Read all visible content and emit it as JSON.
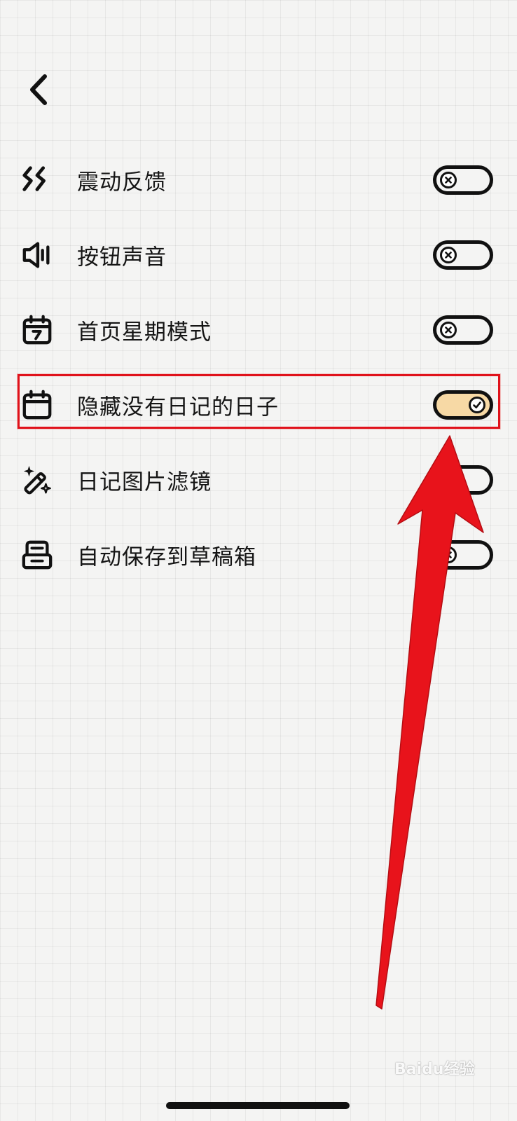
{
  "settings": [
    {
      "label": "震动反馈",
      "icon": "vibration-icon",
      "enabled": false
    },
    {
      "label": "按钮声音",
      "icon": "speaker-icon",
      "enabled": false
    },
    {
      "label": "首页星期模式",
      "icon": "calendar-week-icon",
      "enabled": false
    },
    {
      "label": "隐藏没有日记的日子",
      "icon": "calendar-icon",
      "enabled": true
    },
    {
      "label": "日记图片滤镜",
      "icon": "magic-wand-icon",
      "enabled": false
    },
    {
      "label": "自动保存到草稿箱",
      "icon": "inbox-tray-icon",
      "enabled": false
    }
  ],
  "watermark": {
    "text": "Baidu经验"
  },
  "colors": {
    "background": "#f4f4f3",
    "grid": "#e2e2e1",
    "toggle_on_fill": "#f7d9a5",
    "annotation_red": "#e8131b"
  }
}
